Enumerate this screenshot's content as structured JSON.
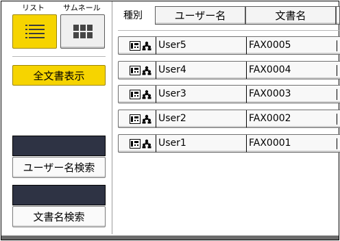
{
  "view": {
    "list_label": "リスト",
    "thumbnail_label": "サムネール",
    "list_icon": "list-icon",
    "thumbnail_icon": "grid-icon"
  },
  "buttons": {
    "show_all": "全文書表示",
    "user_search": "ユーザー名検索",
    "doc_search": "文書名検索"
  },
  "header": {
    "type_label": "種別",
    "user_col": "ユーザー名",
    "doc_col": "文書名"
  },
  "rows": [
    {
      "user": "User5",
      "doc": "FAX0005"
    },
    {
      "user": "User4",
      "doc": "FAX0004"
    },
    {
      "user": "User3",
      "doc": "FAX0003"
    },
    {
      "user": "User2",
      "doc": "FAX0002"
    },
    {
      "user": "User1",
      "doc": "FAX0001"
    }
  ],
  "colors": {
    "accent": "#f6d400",
    "field": "#2e3344"
  }
}
